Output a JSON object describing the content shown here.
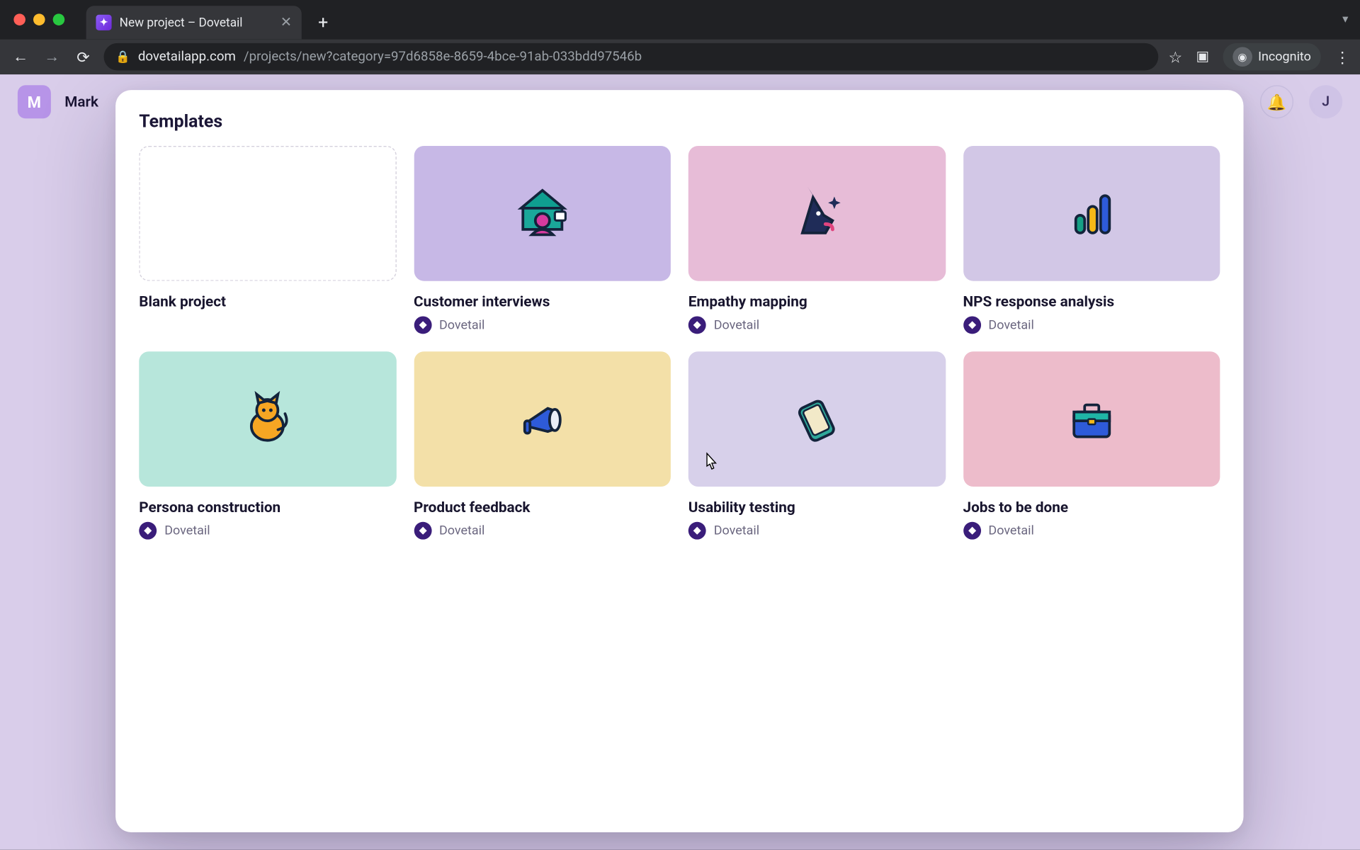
{
  "browser": {
    "tab_title": "New project – Dovetail",
    "url_host": "dovetailapp.com",
    "url_path": "/projects/new?category=97d6858e-8659-4bce-91ab-033bdd97546b",
    "incognito_label": "Incognito"
  },
  "app": {
    "workspace_initial": "M",
    "workspace_name": "Mark",
    "user_initial": "J"
  },
  "modal": {
    "title": "Templates",
    "templates": [
      {
        "title": "Blank project",
        "author": null,
        "bg": "blank"
      },
      {
        "title": "Customer interviews",
        "author": "Dovetail",
        "bg": "purple"
      },
      {
        "title": "Empathy mapping",
        "author": "Dovetail",
        "bg": "pink"
      },
      {
        "title": "NPS response analysis",
        "author": "Dovetail",
        "bg": "lav"
      },
      {
        "title": "Persona construction",
        "author": "Dovetail",
        "bg": "teal"
      },
      {
        "title": "Product feedback",
        "author": "Dovetail",
        "bg": "yellow"
      },
      {
        "title": "Usability testing",
        "author": "Dovetail",
        "bg": "lilac"
      },
      {
        "title": "Jobs to be done",
        "author": "Dovetail",
        "bg": "rose"
      }
    ]
  }
}
